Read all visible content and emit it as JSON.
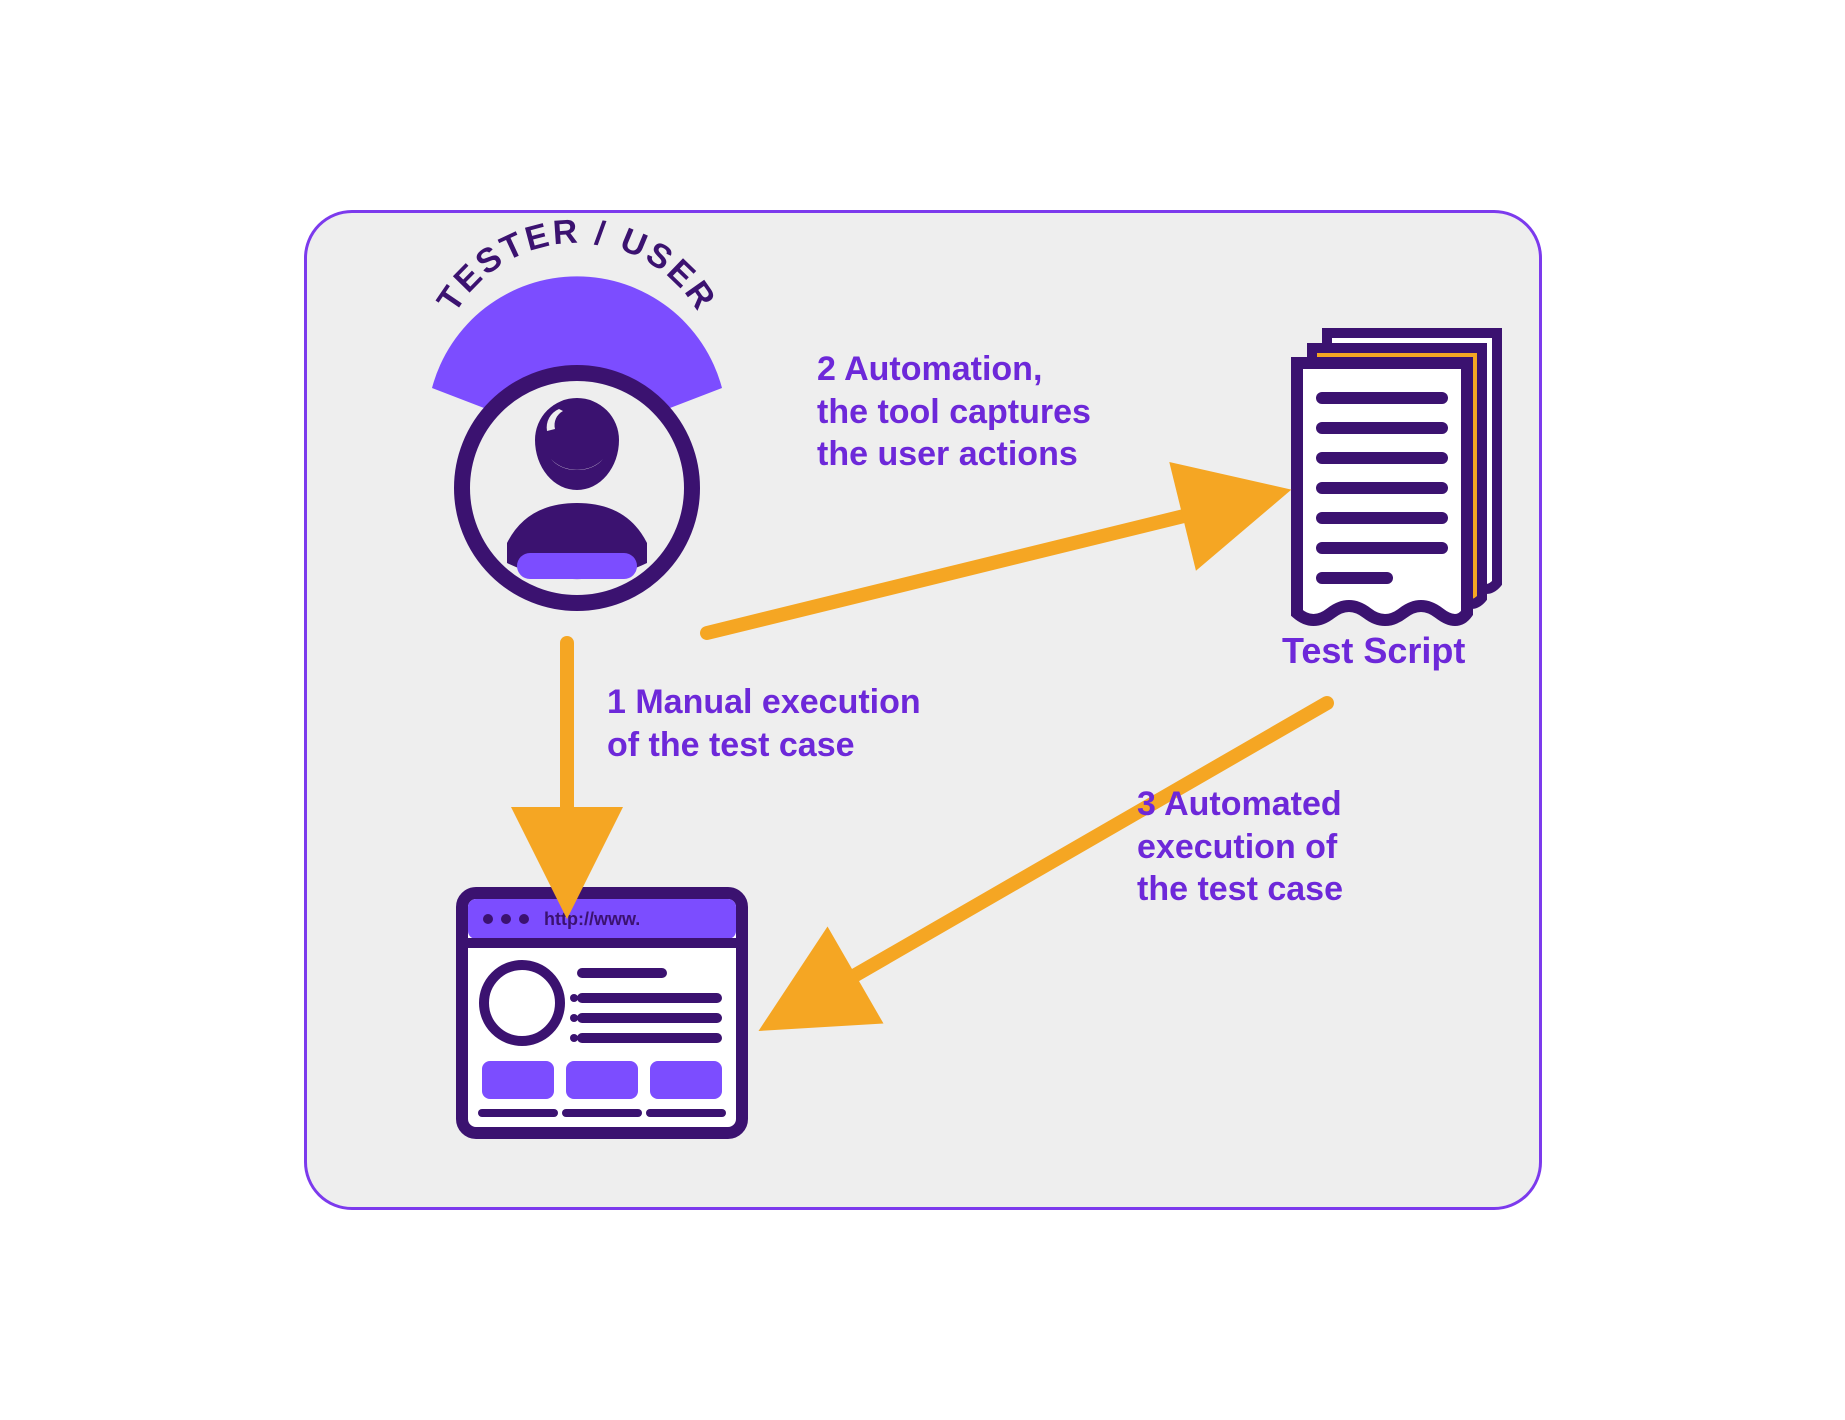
{
  "diagram": {
    "tester_arc_label": "TESTER / USER",
    "test_script_label": "Test Script",
    "browser_url": "http://www.",
    "steps": {
      "one": "1 Manual execution\nof the test case",
      "two": "2 Automation,\nthe tool captures\nthe user actions",
      "three": "3 Automated\nexecution of\nthe test case"
    }
  },
  "colors": {
    "purple_dark": "#3b1270",
    "purple": "#6d28d9",
    "purple_light": "#7c4dff",
    "orange": "#f5a623",
    "bg": "#eeeeee"
  }
}
